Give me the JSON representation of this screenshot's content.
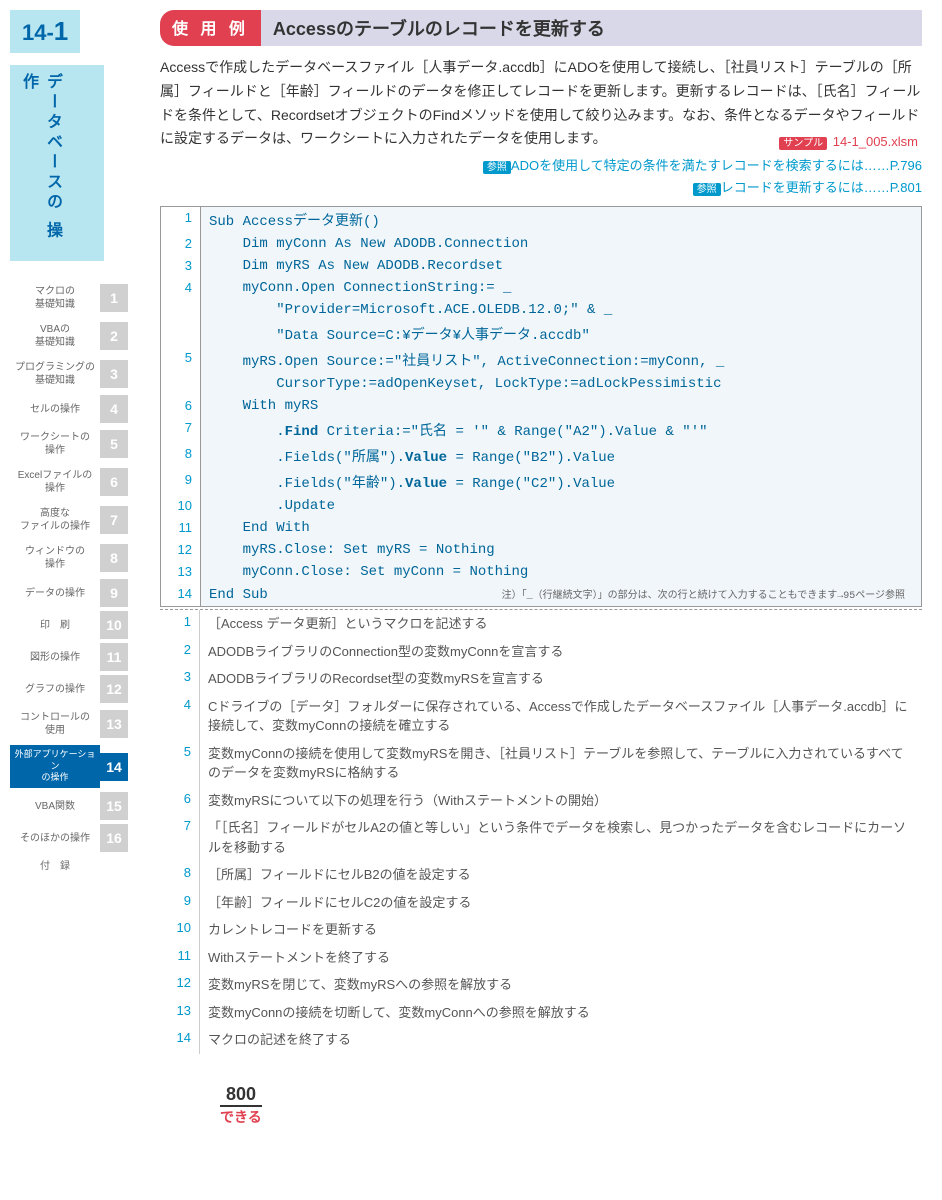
{
  "chapter": "14-1",
  "sideTitle": "データベースの\n操作",
  "nav": [
    {
      "t": "マクロの\n基礎知識",
      "n": "1"
    },
    {
      "t": "VBAの\n基礎知識",
      "n": "2"
    },
    {
      "t": "プログラミングの\n基礎知識",
      "n": "3"
    },
    {
      "t": "セルの操作",
      "n": "4"
    },
    {
      "t": "ワークシートの\n操作",
      "n": "5"
    },
    {
      "t": "Excelファイルの\n操作",
      "n": "6"
    },
    {
      "t": "高度な\nファイルの操作",
      "n": "7"
    },
    {
      "t": "ウィンドウの\n操作",
      "n": "8"
    },
    {
      "t": "データの操作",
      "n": "9"
    },
    {
      "t": "印　刷",
      "n": "10"
    },
    {
      "t": "図形の操作",
      "n": "11"
    },
    {
      "t": "グラフの操作",
      "n": "12"
    },
    {
      "t": "コントロールの\n使用",
      "n": "13"
    },
    {
      "t": "外部アプリケーション\nの操作",
      "n": "14",
      "active": true
    },
    {
      "t": "VBA関数",
      "n": "15"
    },
    {
      "t": "そのほかの操作",
      "n": "16"
    },
    {
      "t": "付　録",
      "n": ""
    }
  ],
  "titleBadge": "使 用 例",
  "title": "Accessのテーブルのレコードを更新する",
  "desc": "Accessで作成したデータベースファイル［人事データ.accdb］にADOを使用して接続し、［社員リスト］テーブルの［所属］フィールドと［年齢］フィールドのデータを修正してレコードを更新します。更新するレコードは、［氏名］フィールドを条件として、RecordsetオブジェクトのFindメソッドを使用して絞り込みます。なお、条件となるデータやフィールドに設定するデータは、ワークシートに入力されたデータを使用します。",
  "sampleBadge": "サンプル",
  "sampleFile": "14-1_005.xlsm",
  "refs": [
    {
      "badge": "参照",
      "text": "ADOを使用して特定の条件を満たすレコードを検索するには……P.796"
    },
    {
      "badge": "参照",
      "text": "レコードを更新するには……P.801"
    }
  ],
  "code": [
    {
      "n": "1",
      "c": "Sub Accessデータ更新()"
    },
    {
      "n": "2",
      "c": "    Dim myConn As New ADODB.Connection"
    },
    {
      "n": "3",
      "c": "    Dim myRS As New ADODB.Recordset"
    },
    {
      "n": "4",
      "c": "    myConn.Open ConnectionString:= _"
    },
    {
      "n": "",
      "c": "        \"Provider=Microsoft.ACE.OLEDB.12.0;\" & _"
    },
    {
      "n": "",
      "c": "        \"Data Source=C:¥データ¥人事データ.accdb\""
    },
    {
      "n": "5",
      "c": "    myRS.Open Source:=\"社員リスト\", ActiveConnection:=myConn, _"
    },
    {
      "n": "",
      "c": "        CursorType:=adOpenKeyset, LockType:=adLockPessimistic"
    },
    {
      "n": "6",
      "c": "    With myRS"
    },
    {
      "n": "7",
      "c": "        .<b>Find</b> Criteria:=\"氏名 = '\" & Range(\"A2\").Value & \"'\""
    },
    {
      "n": "8",
      "c": "        .Fields(\"所属\").<b>Value</b> = Range(\"B2\").Value"
    },
    {
      "n": "9",
      "c": "        .Fields(\"年齢\").<b>Value</b> = Range(\"C2\").Value"
    },
    {
      "n": "10",
      "c": "        .Update"
    },
    {
      "n": "11",
      "c": "    End With"
    },
    {
      "n": "12",
      "c": "    myRS.Close: Set myRS = Nothing"
    },
    {
      "n": "13",
      "c": "    myConn.Close: Set myConn = Nothing"
    },
    {
      "n": "14",
      "c": "End Sub"
    }
  ],
  "codeNote": "注）「_（行継続文字）」の部分は、次の行と続けて入力することもできます→95ページ参照",
  "explain": [
    {
      "n": "1",
      "t": "［Access データ更新］というマクロを記述する"
    },
    {
      "n": "2",
      "t": "ADODBライブラリのConnection型の変数myConnを宣言する"
    },
    {
      "n": "3",
      "t": "ADODBライブラリのRecordset型の変数myRSを宣言する"
    },
    {
      "n": "4",
      "t": "Cドライブの［データ］フォルダーに保存されている、Accessで作成したデータベースファイル［人事データ.accdb］に接続して、変数myConnの接続を確立する"
    },
    {
      "n": "5",
      "t": "変数myConnの接続を使用して変数myRSを開き、［社員リスト］テーブルを参照して、テーブルに入力されているすべてのデータを変数myRSに格納する"
    },
    {
      "n": "6",
      "t": "変数myRSについて以下の処理を行う（Withステートメントの開始）"
    },
    {
      "n": "7",
      "t": "「［氏名］フィールドがセルA2の値と等しい」という条件でデータを検索し、見つかったデータを含むレコードにカーソルを移動する"
    },
    {
      "n": "8",
      "t": "［所属］フィールドにセルB2の値を設定する"
    },
    {
      "n": "9",
      "t": "［年齢］フィールドにセルC2の値を設定する"
    },
    {
      "n": "10",
      "t": "カレントレコードを更新する"
    },
    {
      "n": "11",
      "t": "Withステートメントを終了する"
    },
    {
      "n": "12",
      "t": "変数myRSを閉じて、変数myRSへの参照を解放する"
    },
    {
      "n": "13",
      "t": "変数myConnの接続を切断して、変数myConnへの参照を解放する"
    },
    {
      "n": "14",
      "t": "マクロの記述を終了する"
    }
  ],
  "pageNum": "800",
  "brand": "できる"
}
